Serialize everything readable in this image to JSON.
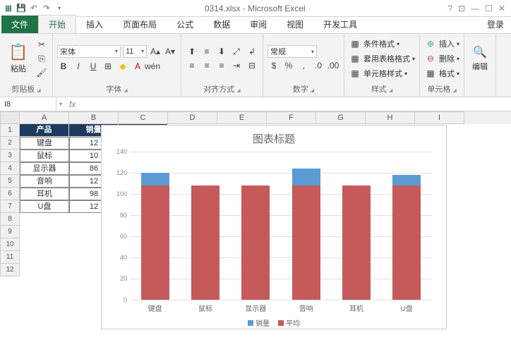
{
  "titlebar": {
    "title": "0314.xlsx - Microsoft Excel"
  },
  "tabs": {
    "file": "文件",
    "home": "开始",
    "insert": "插入",
    "layout": "页面布局",
    "formula": "公式",
    "data": "数据",
    "review": "审阅",
    "view": "视图",
    "dev": "开发工具",
    "login": "登录"
  },
  "ribbon": {
    "clipboard": {
      "label": "剪贴板",
      "paste": "粘贴"
    },
    "font": {
      "label": "字体",
      "name": "宋体",
      "size": "11"
    },
    "align": {
      "label": "对齐方式"
    },
    "number": {
      "label": "数字",
      "format": "常规"
    },
    "styles": {
      "label": "样式",
      "cond": "条件格式",
      "table": "套用表格格式",
      "cell": "单元格样式"
    },
    "cells": {
      "label": "单元格",
      "insert": "插入",
      "delete": "删除",
      "format": "格式"
    },
    "edit": {
      "label": "编辑"
    }
  },
  "formula_bar": {
    "name": "I8",
    "fx": "fx"
  },
  "columns": [
    "A",
    "B",
    "C",
    "D",
    "E",
    "F",
    "G",
    "H",
    "I"
  ],
  "row_count": 12,
  "table": {
    "headers": [
      "产品",
      "销量",
      "平均"
    ],
    "rows": [
      {
        "p": "键盘",
        "v": "12"
      },
      {
        "p": "鼠标",
        "v": "10"
      },
      {
        "p": "显示器",
        "v": "86"
      },
      {
        "p": "音响",
        "v": "12"
      },
      {
        "p": "耳机",
        "v": "98"
      },
      {
        "p": "U盘",
        "v": "12"
      }
    ]
  },
  "chart_data": {
    "type": "bar",
    "title": "图表标题",
    "categories": [
      "键盘",
      "鼠标",
      "显示器",
      "音响",
      "耳机",
      "U盘"
    ],
    "series": [
      {
        "name": "销量",
        "color": "#5b9bd5",
        "values": [
          120,
          108,
          108,
          124,
          108,
          118
        ]
      },
      {
        "name": "平均",
        "color": "#c55a5a",
        "values": [
          108,
          108,
          108,
          108,
          108,
          108
        ]
      }
    ],
    "ylim": [
      0,
      140
    ],
    "yticks": [
      0,
      20,
      40,
      60,
      80,
      100,
      120,
      140
    ]
  }
}
